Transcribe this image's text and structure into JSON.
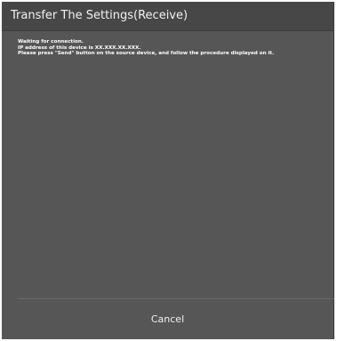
{
  "dialog": {
    "title": "Transfer The Settings(Receive)",
    "message_lines": [
      "Waiting for connection.",
      "IP address of this device is XX.XXX.XX.XXX.",
      "Please press \"Send\" button on the source device, and follow the procedure displayed on it."
    ],
    "cancel_label": "Cancel"
  },
  "colors": {
    "dialog_background": "#565656",
    "titlebar_background": "#474747",
    "text": "#ffffff"
  }
}
